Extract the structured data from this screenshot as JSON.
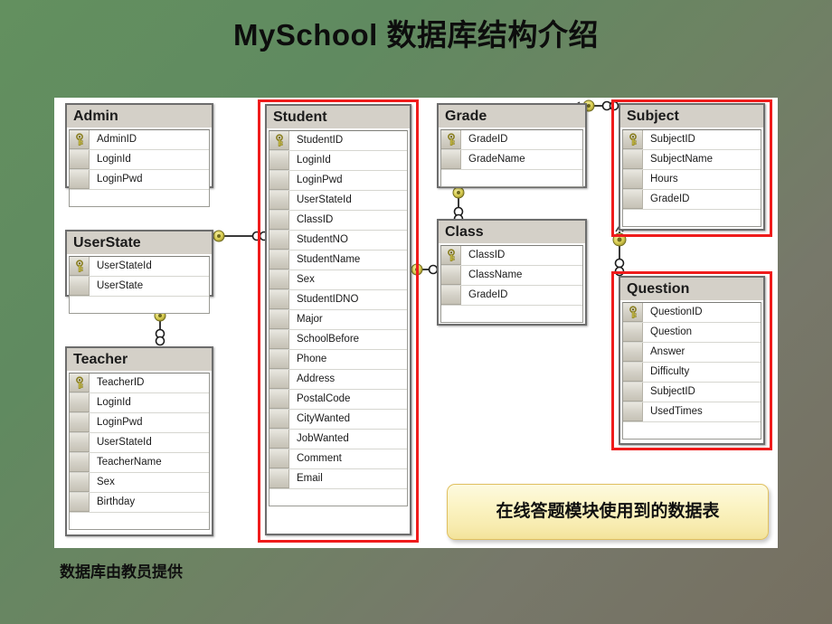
{
  "slide": {
    "title": "MySchool 数据库结构介绍",
    "caption": "数据库由教员提供",
    "callout": "在线答题模块使用到的数据表",
    "colors": {
      "background_green": "#5e8a62",
      "background_gray": "#756f60",
      "canvas": "#ffffff",
      "highlight_border": "#ef1c1c",
      "table_header": "#d4d0c8",
      "callout_fill": "#fbf3c2",
      "key_icon": "#d8cd52"
    }
  },
  "tables": [
    {
      "id": "admin",
      "name": "Admin",
      "highlighted": false,
      "fields": [
        {
          "name": "AdminID",
          "key": true
        },
        {
          "name": "LoginId",
          "key": false
        },
        {
          "name": "LoginPwd",
          "key": false
        }
      ]
    },
    {
      "id": "userstate",
      "name": "UserState",
      "highlighted": false,
      "fields": [
        {
          "name": "UserStateId",
          "key": true
        },
        {
          "name": "UserState",
          "key": false
        }
      ]
    },
    {
      "id": "teacher",
      "name": "Teacher",
      "highlighted": false,
      "fields": [
        {
          "name": "TeacherID",
          "key": true
        },
        {
          "name": "LoginId",
          "key": false
        },
        {
          "name": "LoginPwd",
          "key": false
        },
        {
          "name": "UserStateId",
          "key": false
        },
        {
          "name": "TeacherName",
          "key": false
        },
        {
          "name": "Sex",
          "key": false
        },
        {
          "name": "Birthday",
          "key": false
        }
      ]
    },
    {
      "id": "student",
      "name": "Student",
      "highlighted": true,
      "fields": [
        {
          "name": "StudentID",
          "key": true
        },
        {
          "name": "LoginId",
          "key": false
        },
        {
          "name": "LoginPwd",
          "key": false
        },
        {
          "name": "UserStateId",
          "key": false
        },
        {
          "name": "ClassID",
          "key": false
        },
        {
          "name": "StudentNO",
          "key": false
        },
        {
          "name": "StudentName",
          "key": false
        },
        {
          "name": "Sex",
          "key": false
        },
        {
          "name": "StudentIDNO",
          "key": false
        },
        {
          "name": "Major",
          "key": false
        },
        {
          "name": "SchoolBefore",
          "key": false
        },
        {
          "name": "Phone",
          "key": false
        },
        {
          "name": "Address",
          "key": false
        },
        {
          "name": "PostalCode",
          "key": false
        },
        {
          "name": "CityWanted",
          "key": false
        },
        {
          "name": "JobWanted",
          "key": false
        },
        {
          "name": "Comment",
          "key": false
        },
        {
          "name": "Email",
          "key": false
        }
      ]
    },
    {
      "id": "grade",
      "name": "Grade",
      "highlighted": false,
      "fields": [
        {
          "name": "GradeID",
          "key": true
        },
        {
          "name": "GradeName",
          "key": false
        }
      ]
    },
    {
      "id": "class",
      "name": "Class",
      "highlighted": false,
      "fields": [
        {
          "name": "ClassID",
          "key": true
        },
        {
          "name": "ClassName",
          "key": false
        },
        {
          "name": "GradeID",
          "key": false
        }
      ]
    },
    {
      "id": "subject",
      "name": "Subject",
      "highlighted": true,
      "fields": [
        {
          "name": "SubjectID",
          "key": true
        },
        {
          "name": "SubjectName",
          "key": false
        },
        {
          "name": "Hours",
          "key": false
        },
        {
          "name": "GradeID",
          "key": false
        }
      ]
    },
    {
      "id": "question",
      "name": "Question",
      "highlighted": true,
      "fields": [
        {
          "name": "QuestionID",
          "key": true
        },
        {
          "name": "Question",
          "key": false
        },
        {
          "name": "Answer",
          "key": false
        },
        {
          "name": "Difficulty",
          "key": false
        },
        {
          "name": "SubjectID",
          "key": false
        },
        {
          "name": "UsedTimes",
          "key": false
        }
      ]
    }
  ],
  "relationships": [
    {
      "from": "UserState",
      "to": "Student",
      "type": "one-to-many"
    },
    {
      "from": "UserState",
      "to": "Teacher",
      "type": "one-to-many"
    },
    {
      "from": "Grade",
      "to": "Class",
      "type": "one-to-many"
    },
    {
      "from": "Grade",
      "to": "Subject",
      "type": "one-to-many"
    },
    {
      "from": "Class",
      "to": "Student",
      "type": "one-to-many"
    },
    {
      "from": "Subject",
      "to": "Question",
      "type": "one-to-many"
    }
  ]
}
